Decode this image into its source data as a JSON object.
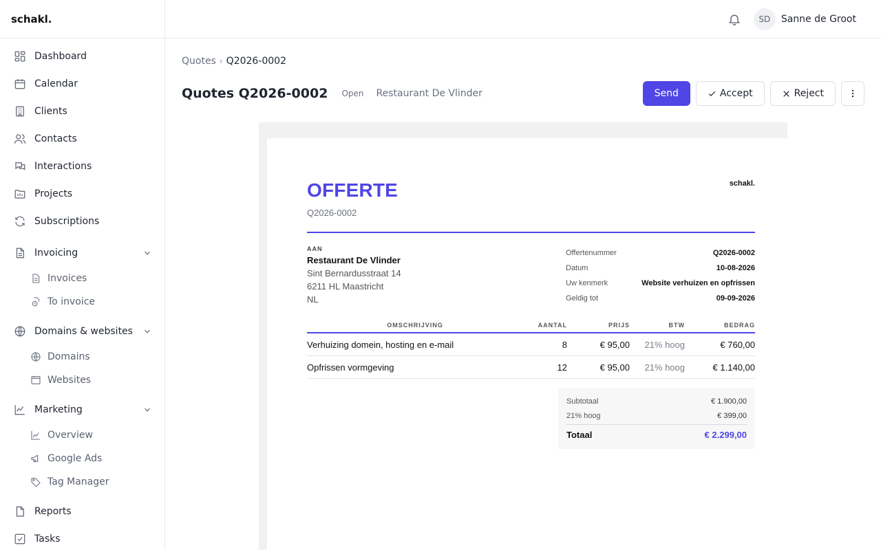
{
  "app": {
    "brand": "schakl."
  },
  "sidebar": {
    "items": [
      {
        "label": "Dashboard",
        "icon": "dashboard-icon"
      },
      {
        "label": "Calendar",
        "icon": "calendar-icon"
      },
      {
        "label": "Clients",
        "icon": "building-icon"
      },
      {
        "label": "Contacts",
        "icon": "users-icon"
      },
      {
        "label": "Interactions",
        "icon": "chat-icon"
      },
      {
        "label": "Projects",
        "icon": "folder-icon"
      },
      {
        "label": "Subscriptions",
        "icon": "refresh-icon"
      },
      {
        "label": "Invoicing",
        "icon": "file-icon",
        "expanded": true,
        "children": [
          {
            "label": "Invoices",
            "icon": "file-text-icon"
          },
          {
            "label": "To invoice",
            "icon": "file-clock-icon"
          }
        ]
      },
      {
        "label": "Domains & websites",
        "icon": "globe-icon",
        "expanded": true,
        "children": [
          {
            "label": "Domains",
            "icon": "globe-icon"
          },
          {
            "label": "Websites",
            "icon": "browser-icon"
          }
        ]
      },
      {
        "label": "Marketing",
        "icon": "chart-icon",
        "expanded": true,
        "children": [
          {
            "label": "Overview",
            "icon": "line-chart-icon"
          },
          {
            "label": "Google Ads",
            "icon": "megaphone-icon"
          },
          {
            "label": "Tag Manager",
            "icon": "tag-icon"
          }
        ]
      },
      {
        "label": "Reports",
        "icon": "file-icon"
      },
      {
        "label": "Tasks",
        "icon": "checkbox-icon"
      }
    ]
  },
  "topbar": {
    "initials": "SD",
    "user_name": "Sanne de Groot"
  },
  "breadcrumb": {
    "parent": "Quotes",
    "separator": "›",
    "current": "Q2026-0002"
  },
  "header": {
    "title": "Quotes Q2026-0002",
    "status": "Open",
    "client": "Restaurant De Vlinder"
  },
  "actions": {
    "send": "Send",
    "accept": "Accept",
    "reject": "Reject"
  },
  "document": {
    "heading": "OFFERTE",
    "number": "Q2026-0002",
    "brand": "schakl.",
    "to_label": "AAN",
    "to": {
      "name": "Restaurant De Vlinder",
      "street": "Sint Bernardusstraat 14",
      "city": "6211 HL Maastricht",
      "country": "NL"
    },
    "meta": [
      {
        "key": "Offertenummer",
        "value": "Q2026-0002"
      },
      {
        "key": "Datum",
        "value": "10-08-2026"
      },
      {
        "key": "Uw kenmerk",
        "value": "Website verhuizen en opfrissen"
      },
      {
        "key": "Geldig tot",
        "value": "09-09-2026"
      }
    ],
    "columns": {
      "desc": "OMSCHRIJVING",
      "qty": "AANTAL",
      "price": "PRIJS",
      "vat": "BTW",
      "amount": "BEDRAG"
    },
    "lines": [
      {
        "desc": "Verhuizing domein, hosting en e-mail",
        "qty": "8",
        "price": "€ 95,00",
        "vat": "21% hoog",
        "amount": "€ 760,00"
      },
      {
        "desc": "Opfrissen vormgeving",
        "qty": "12",
        "price": "€ 95,00",
        "vat": "21% hoog",
        "amount": "€ 1.140,00"
      }
    ],
    "totals": {
      "subtotal_label": "Subtotaal",
      "subtotal": "€ 1.900,00",
      "vat_label": "21% hoog",
      "vat": "€ 399,00",
      "total_label": "Totaal",
      "total": "€ 2.299,00"
    }
  },
  "colors": {
    "accent": "#4f46e5"
  }
}
